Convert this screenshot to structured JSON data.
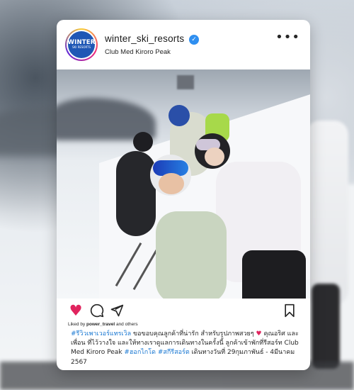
{
  "post": {
    "username": "winter_ski_resorts",
    "location": "Club Med Kiroro Peak",
    "verified_badge": "✓",
    "more_label": "•••",
    "avatar": {
      "logo_top": "WINTER",
      "logo_bottom": "SKI RESORTS"
    },
    "liked_by": {
      "prefix": "Liked by ",
      "user": "power_travel",
      "suffix": " and others"
    },
    "caption": {
      "tag1": "#รีวิวเพาเวอร์แทรเวิล",
      "line1_text": " ขอขอบคุณลูกค้าที่น่ารัก สำหรับรูปภาพสวยๆ ",
      "heart": "♥",
      "line2": "คุณอริศ และเพื่อน ที่ไว้วางใจ และให้ทางเราดูแลการเดินทางในครั้งนี้ ลูกค้าเข้าพักที่รีสอร์ท Club Med Kiroro Peak ",
      "tag2": "#ฮอกไกโด",
      "space": " ",
      "tag3": "#สกีรีสอร์ต",
      "line3": " เดินทางวันที่ 29กุมภาพันธ์ - 4มีนาคม 2567"
    }
  },
  "icons": {
    "like": "heart-icon",
    "comment": "comment-icon",
    "share": "share-icon",
    "save": "bookmark-icon",
    "more": "more-options-icon"
  },
  "colors": {
    "hashtag": "#1877d2",
    "like": "#e0245e",
    "verified": "#2f8ff0"
  }
}
